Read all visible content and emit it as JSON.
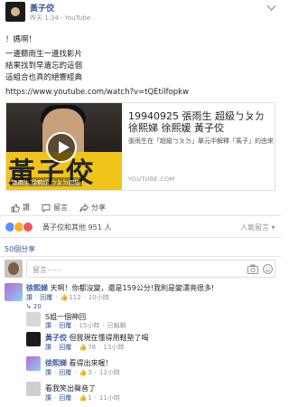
{
  "post": {
    "author": "黃子佼",
    "time": "昨天 1:34",
    "via": "YouTube",
    "lines": [
      "！媽啊！",
      "一邊聽雨生一邊找影片",
      "結果找到早遺忘的這個",
      "這組合也真的絕響經典"
    ],
    "url": "https://www.youtube.com/watch?v=tQEtilfopkw"
  },
  "video": {
    "title": "19940925 張雨生 超級ㄅㄆㄉ 徐熙娣 徐熙媛 黃子佼",
    "description": "張雨生在「超級ㄅㄆㄉ」單元中解釋「馬子」的由來",
    "source": "YOUTUBE.COM",
    "thumb_text": "黃子佼",
    "thumb_caption": "張雨生 徐熙娣 ㄅㄆㄉ超級"
  },
  "actions": {
    "like": "讚",
    "comment": "留言",
    "share": "分享"
  },
  "reactions": {
    "text": "黃子佼和其他 951 人",
    "sort": "人氣留言"
  },
  "shares_text": "50個分享",
  "comment_box": {
    "placeholder": "留言⋯⋯"
  },
  "comments": [
    {
      "name": "徐熙娣",
      "text": "天啊！你都沒變，還是159公分!我則是變漂亮很多!",
      "like": "讚",
      "reply": "回覆",
      "likes": "112",
      "replies": "20",
      "time": "10小時"
    }
  ],
  "replies": [
    {
      "name": "",
      "text": "S姐一個神回",
      "like": "讚",
      "reply": "回覆",
      "time": "15小時",
      "edited": "已編輯"
    },
    {
      "name": "黃子佼",
      "text": "但我現在懂得用鞋墊了喝",
      "like": "讚",
      "reply": "回覆",
      "likes": "76",
      "time": "13小時"
    },
    {
      "name": "徐熙娣",
      "text": "看得出來喔！",
      "like": "讚",
      "reply": "回覆",
      "likes": "3",
      "time": "12小時"
    },
    {
      "name": "",
      "text": "看我笑出聲音了",
      "like": "讚",
      "reply": "回覆",
      "likes": "1",
      "time": "11小時"
    }
  ],
  "colors": {
    "link": "#365899",
    "muted": "#90949c",
    "like_blue": "#5890ff",
    "love_red": "#f25268",
    "haha_yellow": "#f7b125"
  }
}
